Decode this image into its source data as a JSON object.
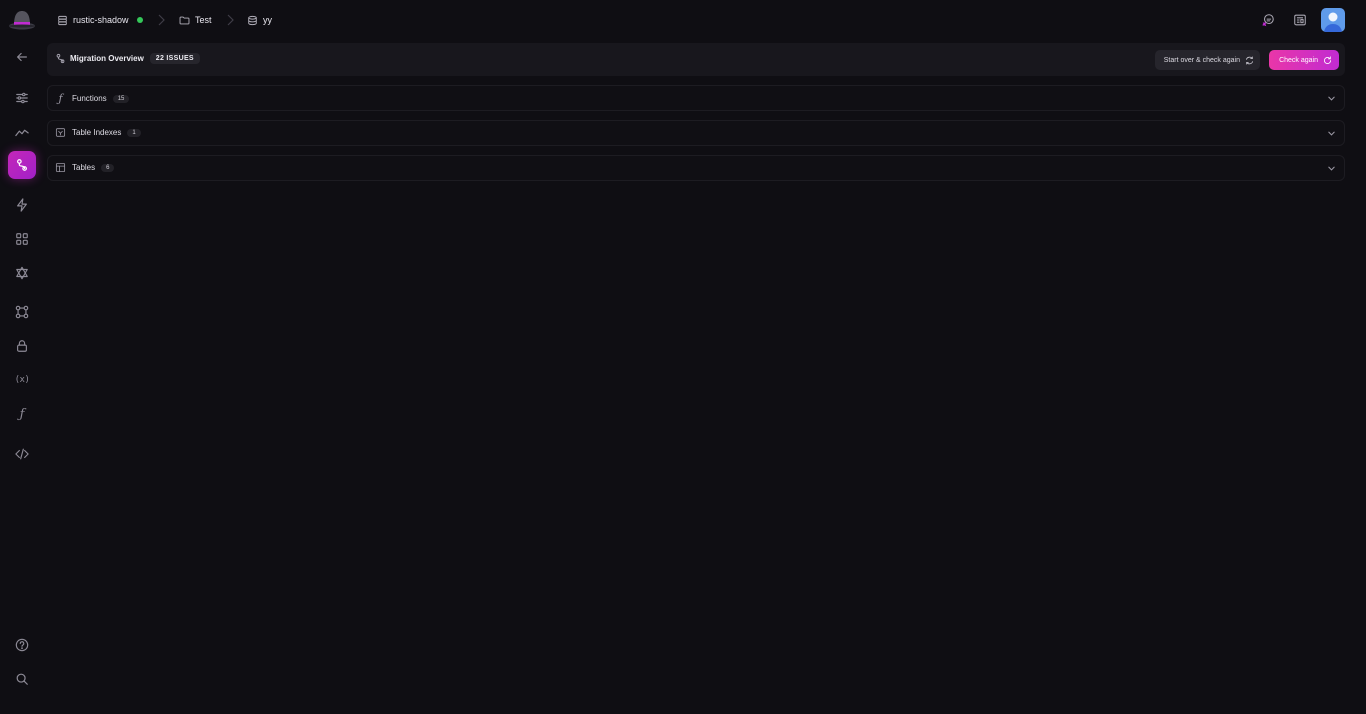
{
  "breadcrumb": {
    "project": "rustic-shadow",
    "folder": "Test",
    "database": "yy"
  },
  "overview": {
    "title": "Migration Overview",
    "issues_badge": "22 ISSUES",
    "start_over_label": "Start over & check again",
    "check_again_label": "Check again"
  },
  "sections": [
    {
      "label": "Functions",
      "count": "15",
      "icon": "function-icon"
    },
    {
      "label": "Table Indexes",
      "count": "1",
      "icon": "index-icon"
    },
    {
      "label": "Tables",
      "count": "6",
      "icon": "table-icon"
    }
  ],
  "sidebar": {
    "icons": [
      "back-arrow-icon",
      "sliders-icon",
      "analytics-icon",
      "migration-icon",
      "bolt-icon",
      "grid-icon",
      "star-of-david-icon",
      "workflow-icon",
      "lock-icon",
      "variable-icon",
      "function-icon",
      "code-icon",
      "help-icon",
      "search-icon"
    ]
  },
  "colors": {
    "background": "#0f0e13",
    "panel": "#18171d",
    "accent": "#e936a8",
    "accent_alt": "#c12bd2",
    "status_online": "#34c759",
    "avatar_bg": "#5f9bea"
  }
}
